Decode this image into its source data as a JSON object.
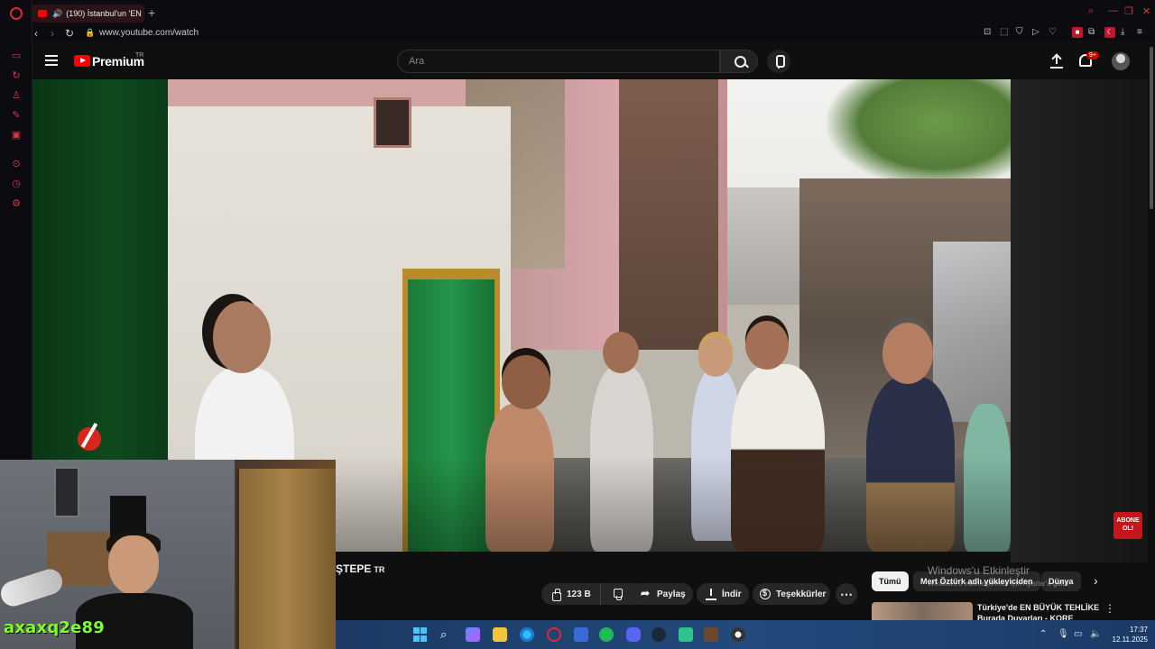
{
  "browser": {
    "tab_title": "(190) İstanbul'un 'EN",
    "url": "www.youtube.com/watch"
  },
  "youtube": {
    "brand": "Premium",
    "brand_region": "TR",
    "search_placeholder": "Ara",
    "notification_badge": "9+"
  },
  "video": {
    "title_visible": "ŞTEPE",
    "title_suffix": "TR",
    "likes": "123 B",
    "share_label": "Paylaş",
    "download_label": "İndir",
    "thanks_label": "Teşekkürler",
    "subscribe_badge": "ABONE OL!"
  },
  "webcam": {
    "username": "axaxq2e89"
  },
  "sidebar": {
    "chips": [
      "Tümü",
      "Mert Öztürk adlı yükleyiciden",
      "Dünya"
    ],
    "recommendation_title": "Türkiye'de EN BÜYÜK TEHLİKE Burada Duvarları - KORE"
  },
  "windows": {
    "activate_title": "Windows'u Etkinleştir",
    "activate_sub": "Windows'u etkinleştirmek için Ayarlar'a gidin.",
    "time": "17:37",
    "date": "12.11.2025"
  },
  "icons": {
    "search": "search-icon",
    "mic": "mic-icon",
    "upload": "upload-icon",
    "bell": "bell-icon",
    "like": "thumb-up-icon",
    "dislike": "thumb-down-icon"
  },
  "colors": {
    "yt_red": "#ff0000",
    "opera_red": "#e0263a",
    "webcam_tag": "#7dff2c"
  }
}
